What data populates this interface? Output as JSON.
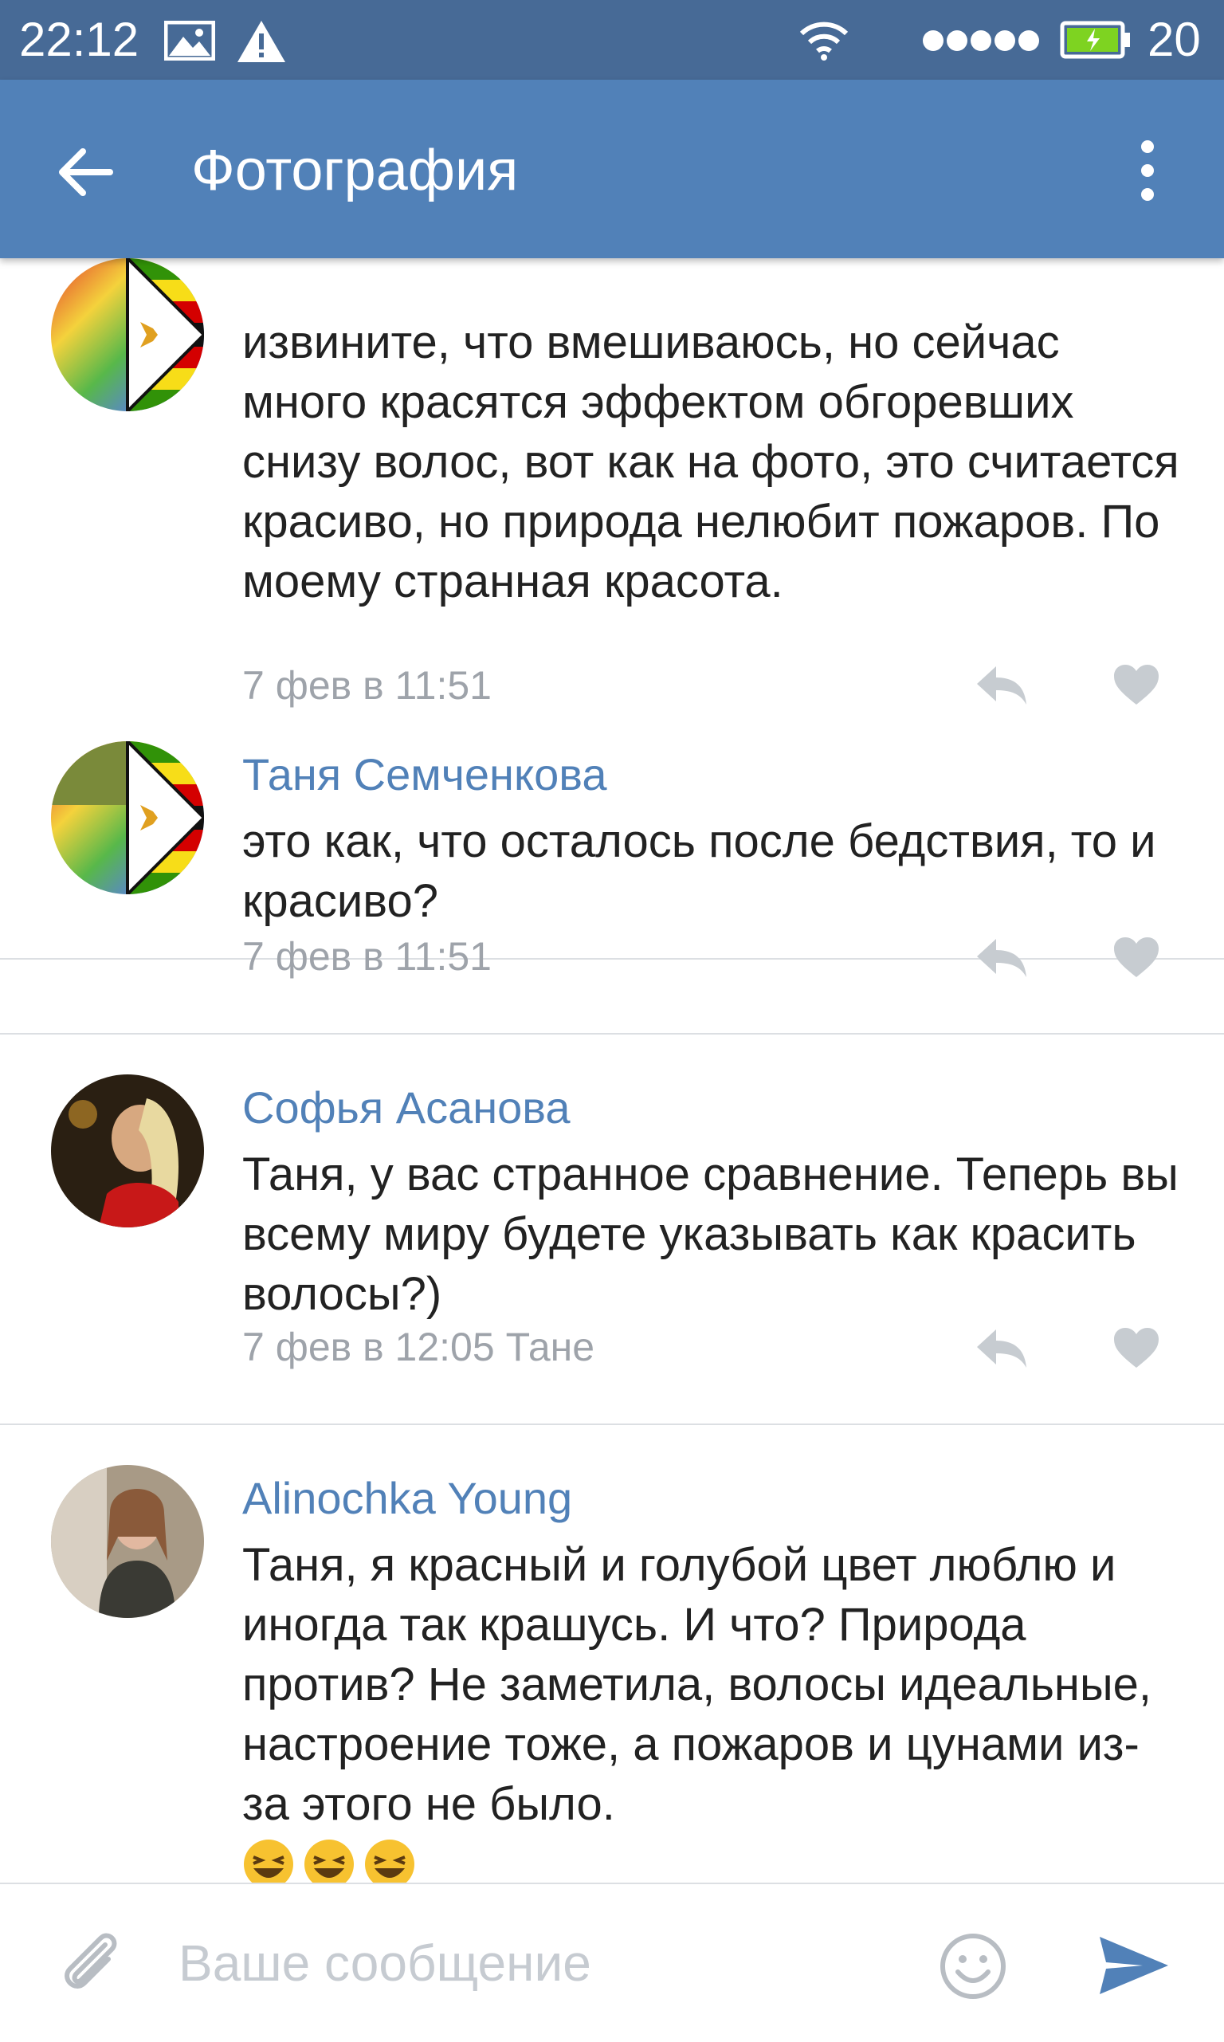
{
  "status_bar": {
    "time": "22:12",
    "battery_level": "20",
    "icons": [
      "image-icon",
      "warning-icon",
      "wifi-icon",
      "signal-dots-icon",
      "battery-charging-icon"
    ]
  },
  "toolbar": {
    "title": "Фотография",
    "back_icon": "arrow-left-icon",
    "menu_icon": "more-vertical-icon"
  },
  "colors": {
    "status_bar": "#476a96",
    "toolbar": "#5181b8",
    "author_name": "#5181b8",
    "meta_text": "#9ea3aa",
    "action_icon": "#c7ccd1",
    "send_icon": "#5181b8",
    "divider": "#dcdfe3"
  },
  "comments": [
    {
      "author": "",
      "text": "извините, что вмешиваюсь, но сейчас много красятся эффектом обгоревших снизу волос, вот как на фото, это считается красиво, но природа нелюбит пожаров. По моему странная красота.",
      "meta": "7 фев в 11:51"
    },
    {
      "author": "Таня Семченкова",
      "text": "это как, что осталось после бедствия, то и красиво?",
      "meta": "7 фев в 11:51"
    },
    {
      "author": "Софья Асанова",
      "text": "Таня, у вас странное сравнение. Теперь вы всему миру будете указывать как красить волосы?)",
      "meta": "7 фев в 12:05 Тане"
    },
    {
      "author": "Alinochka Young",
      "text": "Таня, я красный и голубой цвет люблю и иногда так крашусь. И что? Природа против? Не заметила, волосы идеальные, настроение тоже, а пожаров и цунами из-за этого не было.",
      "emojis": [
        "laughing-emoji",
        "laughing-emoji",
        "laughing-emoji"
      ]
    }
  ],
  "composer": {
    "placeholder": "Ваше сообщение",
    "attach_icon": "paperclip-icon",
    "emoji_icon": "smiley-icon",
    "send_icon": "send-icon"
  }
}
